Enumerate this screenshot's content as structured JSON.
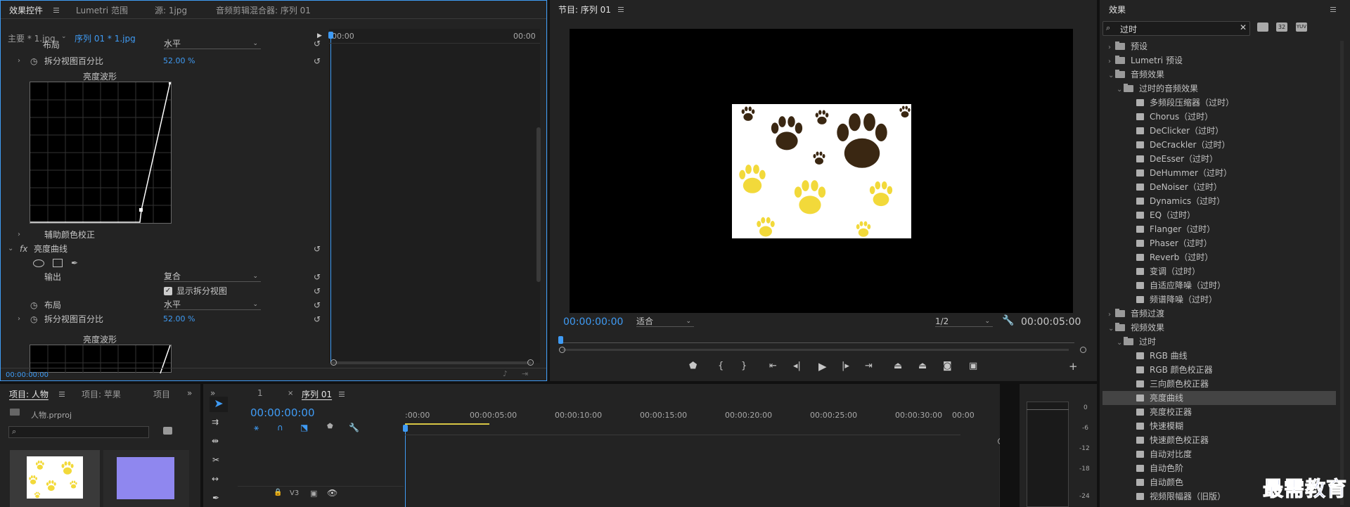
{
  "effect_controls": {
    "tabs": [
      "效果控件",
      "Lumetri 范围",
      "源: 1jpg",
      "音频剪辑混合器: 序列 01"
    ],
    "master_label": "主要 * 1.jpg",
    "seq_label": "序列 01 * 1.jpg",
    "ruler_start": "00:00",
    "ruler_end": "00:00",
    "cut_label": "布局",
    "cut_value": "水平",
    "split_pct_label": "拆分视图百分比",
    "split_pct_value": "52.00 %",
    "waveform_label": "亮度波形",
    "aux_label": "辅助颜色校正",
    "fx_label": "fx",
    "fx_name": "亮度曲线",
    "output_label": "输出",
    "output_value": "复合",
    "show_split_label": "显示拆分视图",
    "layout_label": "布局",
    "layout_value": "水平",
    "split_pct_label2": "拆分视图百分比",
    "split_pct_value2": "52.00 %",
    "waveform_label2": "亮度波形",
    "timecode": "00:00:00:00"
  },
  "program": {
    "title": "节目: 序列 01",
    "timecode": "00:00:00:00",
    "fit": "适合",
    "quality": "1/2",
    "duration": "00:00:05:00"
  },
  "effects": {
    "title": "效果",
    "search_value": "过时",
    "items": [
      {
        "label": "预设",
        "level": 0,
        "type": "folder",
        "expanded": false
      },
      {
        "label": "Lumetri 预设",
        "level": 0,
        "type": "folder",
        "expanded": false
      },
      {
        "label": "音频效果",
        "level": 0,
        "type": "folder",
        "expanded": true
      },
      {
        "label": "过时的音频效果",
        "level": 1,
        "type": "folder",
        "expanded": true
      },
      {
        "label": "多频段压缩器（过时）",
        "level": 2,
        "type": "fx"
      },
      {
        "label": "Chorus（过时）",
        "level": 2,
        "type": "fx"
      },
      {
        "label": "DeClicker（过时）",
        "level": 2,
        "type": "fx"
      },
      {
        "label": "DeCrackler（过时）",
        "level": 2,
        "type": "fx"
      },
      {
        "label": "DeEsser（过时）",
        "level": 2,
        "type": "fx"
      },
      {
        "label": "DeHummer（过时）",
        "level": 2,
        "type": "fx"
      },
      {
        "label": "DeNoiser（过时）",
        "level": 2,
        "type": "fx"
      },
      {
        "label": "Dynamics（过时）",
        "level": 2,
        "type": "fx"
      },
      {
        "label": "EQ（过时）",
        "level": 2,
        "type": "fx"
      },
      {
        "label": "Flanger（过时）",
        "level": 2,
        "type": "fx"
      },
      {
        "label": "Phaser（过时）",
        "level": 2,
        "type": "fx"
      },
      {
        "label": "Reverb（过时）",
        "level": 2,
        "type": "fx"
      },
      {
        "label": "变调（过时）",
        "level": 2,
        "type": "fx"
      },
      {
        "label": "自适应降噪（过时）",
        "level": 2,
        "type": "fx"
      },
      {
        "label": "频谱降噪（过时）",
        "level": 2,
        "type": "fx"
      },
      {
        "label": "音频过渡",
        "level": 0,
        "type": "folder",
        "expanded": false
      },
      {
        "label": "视频效果",
        "level": 0,
        "type": "folder",
        "expanded": true
      },
      {
        "label": "过时",
        "level": 1,
        "type": "folder",
        "expanded": true
      },
      {
        "label": "RGB 曲线",
        "level": 2,
        "type": "fx"
      },
      {
        "label": "RGB 颜色校正器",
        "level": 2,
        "type": "fx"
      },
      {
        "label": "三向颜色校正器",
        "level": 2,
        "type": "fx"
      },
      {
        "label": "亮度曲线",
        "level": 2,
        "type": "fx",
        "selected": true
      },
      {
        "label": "亮度校正器",
        "level": 2,
        "type": "fx"
      },
      {
        "label": "快速模糊",
        "level": 2,
        "type": "fx"
      },
      {
        "label": "快速颜色校正器",
        "level": 2,
        "type": "fx"
      },
      {
        "label": "自动对比度",
        "level": 2,
        "type": "fx"
      },
      {
        "label": "自动色阶",
        "level": 2,
        "type": "fx"
      },
      {
        "label": "自动颜色",
        "level": 2,
        "type": "fx"
      },
      {
        "label": "视频限幅器（旧版）",
        "level": 2,
        "type": "fx"
      }
    ]
  },
  "project": {
    "tabs": [
      "项目: 人物",
      "项目: 苹果",
      "项目"
    ],
    "file": "人物.prproj"
  },
  "timeline": {
    "tabs": [
      "1",
      "序列 01"
    ],
    "timecode": "00:00:00:00",
    "ruler": [
      ":00:00",
      "00:00:05:00",
      "00:00:10:00",
      "00:00:15:00",
      "00:00:20:00",
      "00:00:25:00",
      "00:00:30:00",
      "00:00"
    ],
    "track": "V3"
  },
  "meter": {
    "labels": [
      "0",
      "-6",
      "-12",
      "-18",
      "-24"
    ]
  },
  "watermark": "最需教育",
  "colors": {
    "accent": "#3f9bf4",
    "paw_dark": "#3a2712",
    "paw_yellow": "#f2d93a",
    "watermark": "#1a2fa0"
  }
}
